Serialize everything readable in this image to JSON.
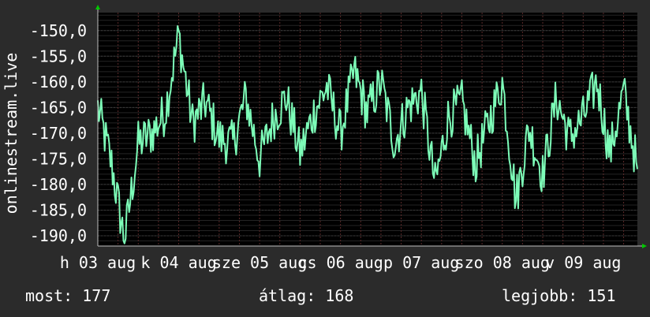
{
  "chart_data": {
    "type": "line",
    "ylabel": "onlinestream.live",
    "ylim": [
      -192,
      -146.5
    ],
    "yticks": [
      -150,
      -155,
      -160,
      -165,
      -170,
      -175,
      -180,
      -185,
      -190
    ],
    "ytick_labels": [
      "-150,0",
      "-155,0",
      "-160,0",
      "-165,0",
      "-170,0",
      "-175,0",
      "-180,0",
      "-185,0",
      "-190,0"
    ],
    "xticks": [
      {
        "label": "h 03 aug",
        "day": 0
      },
      {
        "label": "k 04 aug",
        "day": 1
      },
      {
        "label": "sze 05 aug",
        "day": 2
      },
      {
        "label": "cs 06 aug",
        "day": 3
      },
      {
        "label": "p 07 aug",
        "day": 4
      },
      {
        "label": "szo 08 aug",
        "day": 5
      },
      {
        "label": "v 09 aug",
        "day": 6
      }
    ],
    "xlim_days": [
      0,
      6.67
    ],
    "grid": true,
    "series": [
      {
        "color": "#7dfcb8",
        "x_days": [
          0,
          0.17,
          0.33,
          0.5,
          0.67,
          0.83,
          1,
          1.17,
          1.33,
          1.5,
          1.67,
          1.83,
          2,
          2.17,
          2.33,
          2.5,
          2.67,
          2.83,
          3,
          3.17,
          3.33,
          3.5,
          3.67,
          3.83,
          4,
          4.17,
          4.33,
          4.5,
          4.67,
          4.83,
          5,
          5.17,
          5.33,
          5.5,
          5.67,
          5.83,
          6,
          6.17,
          6.33,
          6.5,
          6.67
        ],
        "values": [
          -165,
          -176,
          -191,
          -172,
          -170,
          -166,
          -151,
          -168,
          -164,
          -171,
          -172,
          -163,
          -175,
          -167,
          -163,
          -174,
          -166,
          -161,
          -170,
          -158,
          -166,
          -160,
          -172,
          -165,
          -162,
          -180,
          -167,
          -164,
          -176,
          -168,
          -160,
          -183,
          -169,
          -178,
          -163,
          -171,
          -167,
          -160,
          -174,
          -162,
          -177
        ]
      }
    ]
  },
  "stats": {
    "now": "most: 177",
    "avg": "átlag: 168",
    "best": "legjobb: 151"
  },
  "colors": {
    "background": "#2b2b2b",
    "plot_background": "#000000",
    "line": "#7dfcb8",
    "grid": "#3a3a3a",
    "vgrid": "#5a2a2a",
    "axis_marker": "#00c800",
    "text": "#ffffff"
  }
}
